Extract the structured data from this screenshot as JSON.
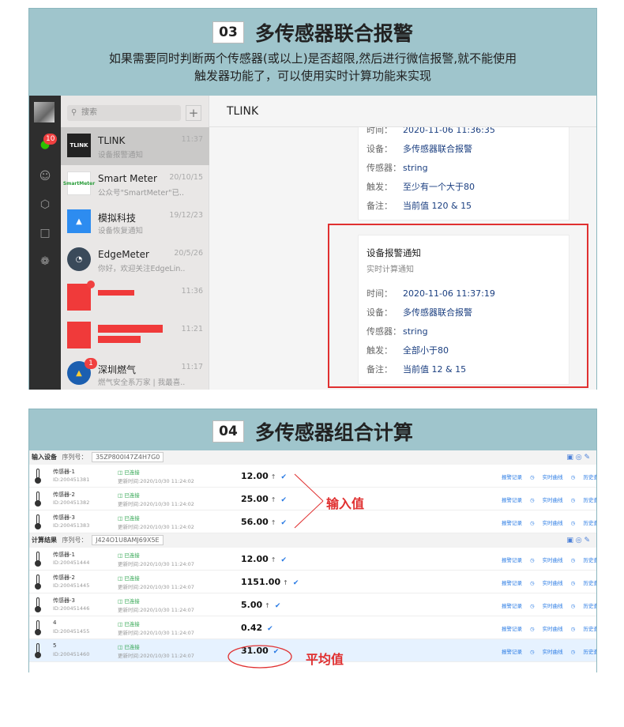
{
  "panel1": {
    "number": "03",
    "title": "多传感器联合报警",
    "subtitle_line1": "如果需要同时判断两个传感器(或以上)是否超限,然后进行微信报警,就不能使用",
    "subtitle_line2": "触发器功能了，可以使用实时计算功能来实现"
  },
  "wechat": {
    "nav_badge": "10",
    "search_placeholder": "搜索",
    "add_label": "+",
    "chats": [
      {
        "name": "TLINK",
        "sub": "设备报警通知",
        "time": "11:37",
        "avatar_text": "TLINK",
        "color": "#222"
      },
      {
        "name": "Smart Meter",
        "sub": "公众号\"SmartMeter\"已...",
        "time": "20/10/15",
        "avatar_text": "SmartMeter",
        "color": "#fff"
      },
      {
        "name": "模拟科技",
        "sub": "设备恢复通知",
        "time": "19/12/23",
        "avatar_text": "",
        "color": "#2d8cf0"
      },
      {
        "name": "EdgeMeter",
        "sub": "你好，欢迎关注EdgeLin...",
        "time": "20/5/26",
        "avatar_text": "",
        "color": "#3a4a5a"
      },
      {
        "name": "",
        "sub": "",
        "time": "11:36",
        "avatar_text": "",
        "color": "#f03a3a"
      },
      {
        "name": "",
        "sub": "",
        "time": "11:21",
        "avatar_text": "",
        "color": "#f03a3a"
      },
      {
        "name": "深圳燃气",
        "sub": "燃气安全系万家 | 我最喜...",
        "time": "11:17",
        "avatar_text": "",
        "color": "#1c5fb0"
      }
    ],
    "chat_badge_red1": "",
    "chat_badge_gas": "1",
    "chat_title": "TLINK",
    "msg1": {
      "time_label": "时间：",
      "time_value": "2020-11-06 11:36:35",
      "device_label": "设备：",
      "device_value": "多传感器联合报警",
      "sensor_label": "传感器：",
      "sensor_value": "string",
      "trigger_label": "触发：",
      "trigger_value": "至少有一个大于80",
      "note_label": "备注：",
      "note_value": "当前值 120 & 15"
    },
    "msg2": {
      "title": "设备报警通知",
      "subtitle": "实时计算通知",
      "time_label": "时间：",
      "time_value": "2020-11-06 11:37:19",
      "device_label": "设备：",
      "device_value": "多传感器联合报警",
      "sensor_label": "传感器：",
      "sensor_value": "string",
      "trigger_label": "触发：",
      "trigger_value": "全部小于80",
      "note_label": "备注：",
      "note_value": "当前值  12 & 15"
    }
  },
  "panel2": {
    "number": "04",
    "title": "多传感器组合计算",
    "input_section": {
      "label": "输入设备",
      "serial_label": "序列号：",
      "serial_value": "35ZP800I47Z4H7G0"
    },
    "result_section": {
      "label": "计算结果",
      "serial_label": "序列号：",
      "serial_value": "J424O1U8AMJ69X5E"
    },
    "status_text": "已连接",
    "update_prefix": "更新时间:",
    "link_labels": [
      "报警记录",
      "实时曲线",
      "历史查询"
    ],
    "input_rows": [
      {
        "name": "传感器-1",
        "id": "ID:200451381",
        "updated": "2020/10/30 11:24:02",
        "value": "12.00"
      },
      {
        "name": "传感器-2",
        "id": "ID:200451382",
        "updated": "2020/10/30 11:24:02",
        "value": "25.00"
      },
      {
        "name": "传感器-3",
        "id": "ID:200451383",
        "updated": "2020/10/30 11:24:02",
        "value": "56.00"
      }
    ],
    "result_rows": [
      {
        "name": "传感器-1",
        "id": "ID:200451444",
        "updated": "2020/10/30 11:24:07",
        "value": "12.00"
      },
      {
        "name": "传感器-2",
        "id": "ID:200451445",
        "updated": "2020/10/30 11:24:07",
        "value": "1151.00"
      },
      {
        "name": "传感器-3",
        "id": "ID:200451446",
        "updated": "2020/10/30 11:24:07",
        "value": "5.00"
      },
      {
        "name": "4",
        "id": "ID:200451455",
        "updated": "2020/10/30 11:24:07",
        "value": "0.42"
      },
      {
        "name": "5",
        "id": "ID:200451460",
        "updated": "2020/10/30 11:24:07",
        "value": "31.00"
      }
    ],
    "annotation_input": "输入值",
    "annotation_avg": "平均值"
  }
}
